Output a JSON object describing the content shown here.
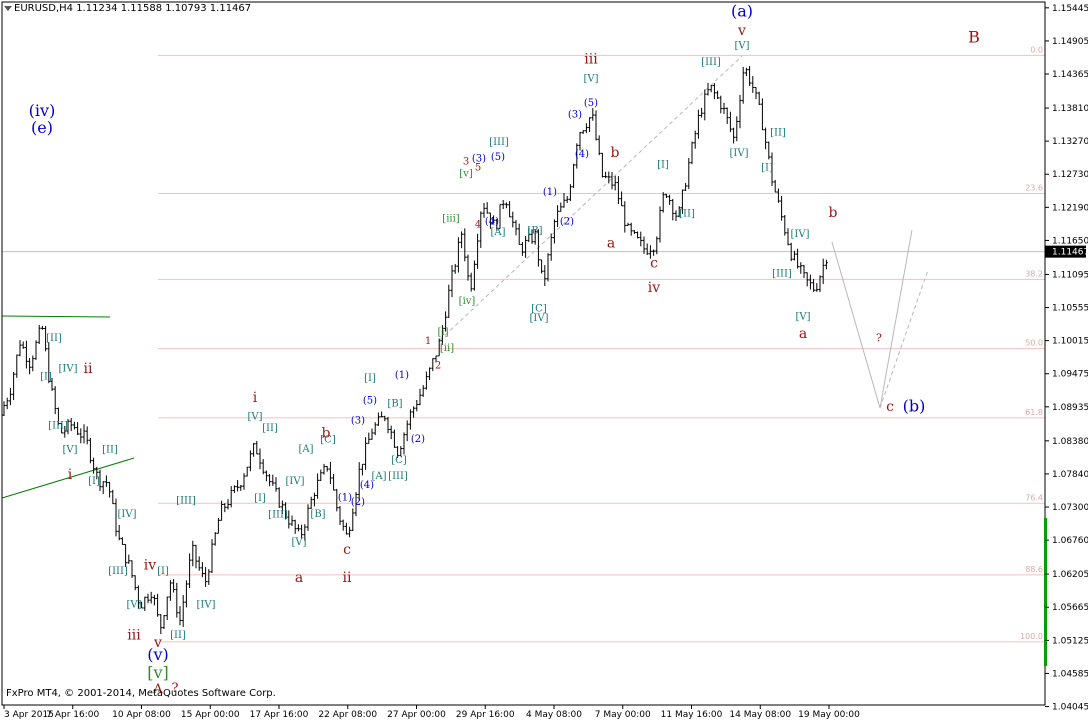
{
  "header": {
    "text": "EURUSD,H4  1.11234 1.11588 1.10793 1.11467"
  },
  "footer": {
    "text": "FxPro MT4, © 2001-2014, MetaQuotes Software Corp."
  },
  "colors": {
    "background": "#ffffff",
    "axis": "#000000",
    "candle": "#000000",
    "fib_line": "#f2c0c0",
    "fib_label": "#d8a8a8",
    "current_price_line": "#c0c0c0",
    "price_box": "#000000",
    "wave_blue": "#0000cc",
    "wave_red": "#9b1515",
    "wave_teal": "#1a7a7a",
    "wave_green": "#2e8b2e",
    "trend_green": "#008000",
    "channel_gray": "#b8b8b8",
    "right_bar": "#00a000"
  },
  "chart_data": {
    "type": "candlestick",
    "symbol": "EURUSD",
    "timeframe": "H4",
    "ohlc_last": {
      "open": 1.11234,
      "high": 1.11588,
      "low": 1.10793,
      "close": 1.11467
    },
    "current_price": "1.11467",
    "y_range": [
      1.0407,
      1.1554
    ],
    "y_ticks": [
      "1.15445",
      "1.14905",
      "1.14365",
      "1.13810",
      "1.13270",
      "1.12730",
      "1.12190",
      "1.11650",
      "1.11095",
      "1.10555",
      "1.10015",
      "1.09475",
      "1.08935",
      "1.08380",
      "1.07840",
      "1.07300",
      "1.06760",
      "1.06205",
      "1.05665",
      "1.05125",
      "1.04585",
      "1.04045"
    ],
    "x_labels": [
      "3 Apr 2015",
      "7 Apr 16:00",
      "10 Apr 08:00",
      "15 Apr 00:00",
      "17 Apr 16:00",
      "22 Apr 08:00",
      "27 Apr 00:00",
      "29 Apr 16:00",
      "4 May 08:00",
      "7 May 00:00",
      "11 May 16:00",
      "14 May 08:00",
      "19 May 00:00"
    ],
    "fib_levels": [
      {
        "label": "0.0",
        "price": 1.1467
      },
      {
        "label": "23.6",
        "price": 1.12415
      },
      {
        "label": "38.2",
        "price": 1.11015
      },
      {
        "label": "50.0",
        "price": 1.09885
      },
      {
        "label": "61.8",
        "price": 1.08755
      },
      {
        "label": "76.4",
        "price": 1.07361
      },
      {
        "label": "88.6",
        "price": 1.06194
      },
      {
        "label": "100.0",
        "price": 1.051
      }
    ],
    "price_path": [
      [
        0,
        1.088
      ],
      [
        10,
        1.092
      ],
      [
        20,
        1.1
      ],
      [
        30,
        1.0965
      ],
      [
        42,
        1.1025
      ],
      [
        50,
        1.093
      ],
      [
        60,
        1.085
      ],
      [
        72,
        1.0865
      ],
      [
        86,
        1.084
      ],
      [
        98,
        1.0775
      ],
      [
        108,
        1.077
      ],
      [
        118,
        1.068
      ],
      [
        130,
        1.063
      ],
      [
        140,
        1.057
      ],
      [
        152,
        1.0595
      ],
      [
        160,
        1.053
      ],
      [
        170,
        1.061
      ],
      [
        180,
        1.0545
      ],
      [
        192,
        1.066
      ],
      [
        205,
        1.0605
      ],
      [
        220,
        1.072
      ],
      [
        240,
        1.077
      ],
      [
        255,
        1.083
      ],
      [
        270,
        1.077
      ],
      [
        285,
        1.072
      ],
      [
        300,
        1.068
      ],
      [
        315,
        1.076
      ],
      [
        328,
        1.08
      ],
      [
        338,
        1.072
      ],
      [
        347,
        1.068
      ],
      [
        360,
        1.0795
      ],
      [
        372,
        1.0855
      ],
      [
        385,
        1.088
      ],
      [
        398,
        1.082
      ],
      [
        410,
        1.088
      ],
      [
        425,
        1.093
      ],
      [
        440,
        1.1
      ],
      [
        450,
        1.109
      ],
      [
        462,
        1.118
      ],
      [
        470,
        1.108
      ],
      [
        482,
        1.123
      ],
      [
        495,
        1.1185
      ],
      [
        505,
        1.124
      ],
      [
        520,
        1.115
      ],
      [
        535,
        1.1175
      ],
      [
        543,
        1.109
      ],
      [
        555,
        1.12
      ],
      [
        568,
        1.1235
      ],
      [
        578,
        1.134
      ],
      [
        592,
        1.137
      ],
      [
        602,
        1.127
      ],
      [
        615,
        1.1255
      ],
      [
        628,
        1.118
      ],
      [
        645,
        1.115
      ],
      [
        655,
        1.116
      ],
      [
        665,
        1.125
      ],
      [
        678,
        1.12
      ],
      [
        690,
        1.13
      ],
      [
        700,
        1.1375
      ],
      [
        710,
        1.1415
      ],
      [
        722,
        1.1385
      ],
      [
        734,
        1.133
      ],
      [
        744,
        1.145
      ],
      [
        752,
        1.142
      ],
      [
        762,
        1.136
      ],
      [
        772,
        1.1265
      ],
      [
        782,
        1.12
      ],
      [
        792,
        1.114
      ],
      [
        805,
        1.11
      ],
      [
        815,
        1.1085
      ],
      [
        828,
        1.1147
      ]
    ],
    "wave_labels": [
      {
        "text": "(iv)",
        "x": 42,
        "y": 1.1375,
        "color": "blue",
        "size": 16
      },
      {
        "text": "(e)",
        "x": 42,
        "y": 1.1348,
        "color": "blue",
        "size": 16
      },
      {
        "text": "[II]",
        "x": 54,
        "y": 1.1005,
        "color": "teal",
        "size": 10
      },
      {
        "text": "[I]",
        "x": 46,
        "y": 1.0942,
        "color": "teal",
        "size": 10
      },
      {
        "text": "[IV]",
        "x": 68,
        "y": 1.0955,
        "color": "teal",
        "size": 10
      },
      {
        "text": "ii",
        "x": 88,
        "y": 1.0955,
        "color": "red",
        "size": 14
      },
      {
        "text": "[III]",
        "x": 58,
        "y": 1.0862,
        "color": "teal",
        "size": 10
      },
      {
        "text": "[V]",
        "x": 70,
        "y": 1.0823,
        "color": "teal",
        "size": 10
      },
      {
        "text": "[II]",
        "x": 110,
        "y": 1.0823,
        "color": "teal",
        "size": 10
      },
      {
        "text": "[I]",
        "x": 94,
        "y": 1.0772,
        "color": "teal",
        "size": 10
      },
      {
        "text": "i",
        "x": 70,
        "y": 1.0782,
        "color": "red",
        "size": 14
      },
      {
        "text": "[IV]",
        "x": 127,
        "y": 1.0718,
        "color": "teal",
        "size": 10
      },
      {
        "text": "[III]",
        "x": 118,
        "y": 1.0625,
        "color": "teal",
        "size": 10
      },
      {
        "text": "iv",
        "x": 150,
        "y": 1.0635,
        "color": "red",
        "size": 14
      },
      {
        "text": "[I]",
        "x": 163,
        "y": 1.0625,
        "color": "teal",
        "size": 10
      },
      {
        "text": "[V]",
        "x": 134,
        "y": 1.057,
        "color": "teal",
        "size": 10
      },
      {
        "text": "iii",
        "x": 134,
        "y": 1.052,
        "color": "red",
        "size": 14
      },
      {
        "text": "[II]",
        "x": 178,
        "y": 1.052,
        "color": "teal",
        "size": 10
      },
      {
        "text": "v",
        "x": 158,
        "y": 1.0508,
        "color": "red",
        "size": 14
      },
      {
        "text": "(v)",
        "x": 158,
        "y": 1.0488,
        "color": "blue",
        "size": 16
      },
      {
        "text": "[v]",
        "x": 158,
        "y": 1.0458,
        "color": "green",
        "size": 16
      },
      {
        "text": "[III]",
        "x": 186,
        "y": 1.074,
        "color": "teal",
        "size": 10
      },
      {
        "text": "[IV]",
        "x": 206,
        "y": 1.057,
        "color": "teal",
        "size": 10
      },
      {
        "text": "i",
        "x": 255,
        "y": 1.0908,
        "color": "red",
        "size": 14
      },
      {
        "text": "[V]",
        "x": 255,
        "y": 1.0877,
        "color": "teal",
        "size": 10
      },
      {
        "text": "[II]",
        "x": 270,
        "y": 1.0858,
        "color": "teal",
        "size": 10
      },
      {
        "text": "[I]",
        "x": 260,
        "y": 1.0744,
        "color": "teal",
        "size": 10
      },
      {
        "text": "[IV]",
        "x": 295,
        "y": 1.0772,
        "color": "teal",
        "size": 10
      },
      {
        "text": "[III]",
        "x": 278,
        "y": 1.0717,
        "color": "teal",
        "size": 10
      },
      {
        "text": "[A]",
        "x": 306,
        "y": 1.0824,
        "color": "teal",
        "size": 10
      },
      {
        "text": "b",
        "x": 326,
        "y": 1.085,
        "color": "red",
        "size": 14
      },
      {
        "text": "[C]",
        "x": 328,
        "y": 1.0839,
        "color": "teal",
        "size": 10
      },
      {
        "text": "[B]",
        "x": 318,
        "y": 1.0718,
        "color": "teal",
        "size": 10
      },
      {
        "text": "[V]",
        "x": 299,
        "y": 1.0672,
        "color": "teal",
        "size": 10
      },
      {
        "text": "a",
        "x": 299,
        "y": 1.0614,
        "color": "red",
        "size": 14
      },
      {
        "text": "c",
        "x": 347,
        "y": 1.066,
        "color": "red",
        "size": 14
      },
      {
        "text": "ii",
        "x": 347,
        "y": 1.0614,
        "color": "red",
        "size": 14
      },
      {
        "text": "(1)",
        "x": 345,
        "y": 1.0745,
        "color": "blue",
        "size": 10
      },
      {
        "text": "(2)",
        "x": 358,
        "y": 1.0737,
        "color": "blue",
        "size": 10
      },
      {
        "text": "(3)",
        "x": 358,
        "y": 1.087,
        "color": "blue",
        "size": 10
      },
      {
        "text": "(4)",
        "x": 367,
        "y": 1.0765,
        "color": "blue",
        "size": 10
      },
      {
        "text": "(5)",
        "x": 370,
        "y": 1.0903,
        "color": "blue",
        "size": 10
      },
      {
        "text": "[I]",
        "x": 370,
        "y": 1.094,
        "color": "teal",
        "size": 10
      },
      {
        "text": "[A]",
        "x": 379,
        "y": 1.078,
        "color": "teal",
        "size": 10
      },
      {
        "text": "[III]",
        "x": 398,
        "y": 1.078,
        "color": "teal",
        "size": 10
      },
      {
        "text": "[C]",
        "x": 399,
        "y": 1.0806,
        "color": "teal",
        "size": 10
      },
      {
        "text": "[B]",
        "x": 395,
        "y": 1.0898,
        "color": "teal",
        "size": 10
      },
      {
        "text": "(1)",
        "x": 402,
        "y": 1.0945,
        "color": "blue",
        "size": 10
      },
      {
        "text": "(2)",
        "x": 418,
        "y": 1.084,
        "color": "blue",
        "size": 10
      },
      {
        "text": "1",
        "x": 428,
        "y": 1.1,
        "color": "red",
        "size": 10
      },
      {
        "text": "2",
        "x": 438,
        "y": 1.096,
        "color": "red",
        "size": 10
      },
      {
        "text": "[i]",
        "x": 443,
        "y": 1.1015,
        "color": "green",
        "size": 10
      },
      {
        "text": "[ii]",
        "x": 447,
        "y": 1.0989,
        "color": "green",
        "size": 10
      },
      {
        "text": "[iv]",
        "x": 467,
        "y": 1.1065,
        "color": "green",
        "size": 10
      },
      {
        "text": "[iii]",
        "x": 451,
        "y": 1.12,
        "color": "green",
        "size": 10
      },
      {
        "text": "3",
        "x": 466,
        "y": 1.1293,
        "color": "red",
        "size": 10
      },
      {
        "text": "4",
        "x": 478,
        "y": 1.119,
        "color": "red",
        "size": 10
      },
      {
        "text": "5",
        "x": 478,
        "y": 1.1283,
        "color": "red",
        "size": 10
      },
      {
        "text": "[v]",
        "x": 466,
        "y": 1.1273,
        "color": "green",
        "size": 10
      },
      {
        "text": "(3)",
        "x": 479,
        "y": 1.1298,
        "color": "blue",
        "size": 10
      },
      {
        "text": "(4)",
        "x": 492,
        "y": 1.1195,
        "color": "blue",
        "size": 10
      },
      {
        "text": "(5)",
        "x": 498,
        "y": 1.13,
        "color": "blue",
        "size": 10
      },
      {
        "text": "[III]",
        "x": 499,
        "y": 1.1325,
        "color": "teal",
        "size": 10
      },
      {
        "text": "[A]",
        "x": 498,
        "y": 1.1178,
        "color": "teal",
        "size": 10
      },
      {
        "text": "(1)",
        "x": 550,
        "y": 1.1243,
        "color": "blue",
        "size": 10
      },
      {
        "text": "(2)",
        "x": 567,
        "y": 1.1195,
        "color": "blue",
        "size": 10
      },
      {
        "text": "[B]",
        "x": 535,
        "y": 1.118,
        "color": "teal",
        "size": 10
      },
      {
        "text": "[C]",
        "x": 539,
        "y": 1.1053,
        "color": "teal",
        "size": 10
      },
      {
        "text": "[IV]",
        "x": 539,
        "y": 1.1038,
        "color": "teal",
        "size": 10
      },
      {
        "text": "(3)",
        "x": 575,
        "y": 1.137,
        "color": "blue",
        "size": 10
      },
      {
        "text": "(5)",
        "x": 591,
        "y": 1.1388,
        "color": "blue",
        "size": 10
      },
      {
        "text": "(4)",
        "x": 582,
        "y": 1.1305,
        "color": "blue",
        "size": 10
      },
      {
        "text": "iii",
        "x": 591,
        "y": 1.146,
        "color": "red",
        "size": 14
      },
      {
        "text": "[V]",
        "x": 591,
        "y": 1.1428,
        "color": "teal",
        "size": 10
      },
      {
        "text": "b",
        "x": 615,
        "y": 1.1308,
        "color": "red",
        "size": 14
      },
      {
        "text": "a",
        "x": 611,
        "y": 1.116,
        "color": "red",
        "size": 14
      },
      {
        "text": "[I]",
        "x": 663,
        "y": 1.1288,
        "color": "teal",
        "size": 10
      },
      {
        "text": "[II]",
        "x": 687,
        "y": 1.1208,
        "color": "teal",
        "size": 10
      },
      {
        "text": "c",
        "x": 654,
        "y": 1.1127,
        "color": "red",
        "size": 14
      },
      {
        "text": "iv",
        "x": 654,
        "y": 1.1087,
        "color": "red",
        "size": 14
      },
      {
        "text": "[III]",
        "x": 711,
        "y": 1.1455,
        "color": "teal",
        "size": 10
      },
      {
        "text": "(a)",
        "x": 742,
        "y": 1.1538,
        "color": "blue",
        "size": 16
      },
      {
        "text": "v",
        "x": 742,
        "y": 1.1507,
        "color": "red",
        "size": 14
      },
      {
        "text": "[V]",
        "x": 742,
        "y": 1.1482,
        "color": "teal",
        "size": 10
      },
      {
        "text": "[IV]",
        "x": 739,
        "y": 1.1307,
        "color": "teal",
        "size": 10
      },
      {
        "text": "[II]",
        "x": 778,
        "y": 1.134,
        "color": "teal",
        "size": 10
      },
      {
        "text": "[I]",
        "x": 767,
        "y": 1.1283,
        "color": "teal",
        "size": 10
      },
      {
        "text": "B",
        "x": 974,
        "y": 1.1495,
        "color": "red",
        "size": 16
      },
      {
        "text": "b",
        "x": 833,
        "y": 1.121,
        "color": "red",
        "size": 14
      },
      {
        "text": "[IV]",
        "x": 800,
        "y": 1.1175,
        "color": "teal",
        "size": 10
      },
      {
        "text": "[III]",
        "x": 782,
        "y": 1.111,
        "color": "teal",
        "size": 10
      },
      {
        "text": "[V]",
        "x": 803,
        "y": 1.104,
        "color": "teal",
        "size": 10
      },
      {
        "text": "a",
        "x": 803,
        "y": 1.1012,
        "color": "red",
        "size": 14
      },
      {
        "text": "?",
        "x": 879,
        "y": 1.1005,
        "color": "red",
        "size": 11
      },
      {
        "text": "c",
        "x": 890,
        "y": 1.0893,
        "color": "red",
        "size": 14
      },
      {
        "text": "(b)",
        "x": 914,
        "y": 1.0893,
        "color": "blue",
        "size": 16
      },
      {
        "text": "A",
        "x": 158,
        "y": 1.0432,
        "color": "red",
        "size": 13
      },
      {
        "text": "?",
        "x": 175,
        "y": 1.0434,
        "color": "red",
        "size": 13
      }
    ]
  }
}
